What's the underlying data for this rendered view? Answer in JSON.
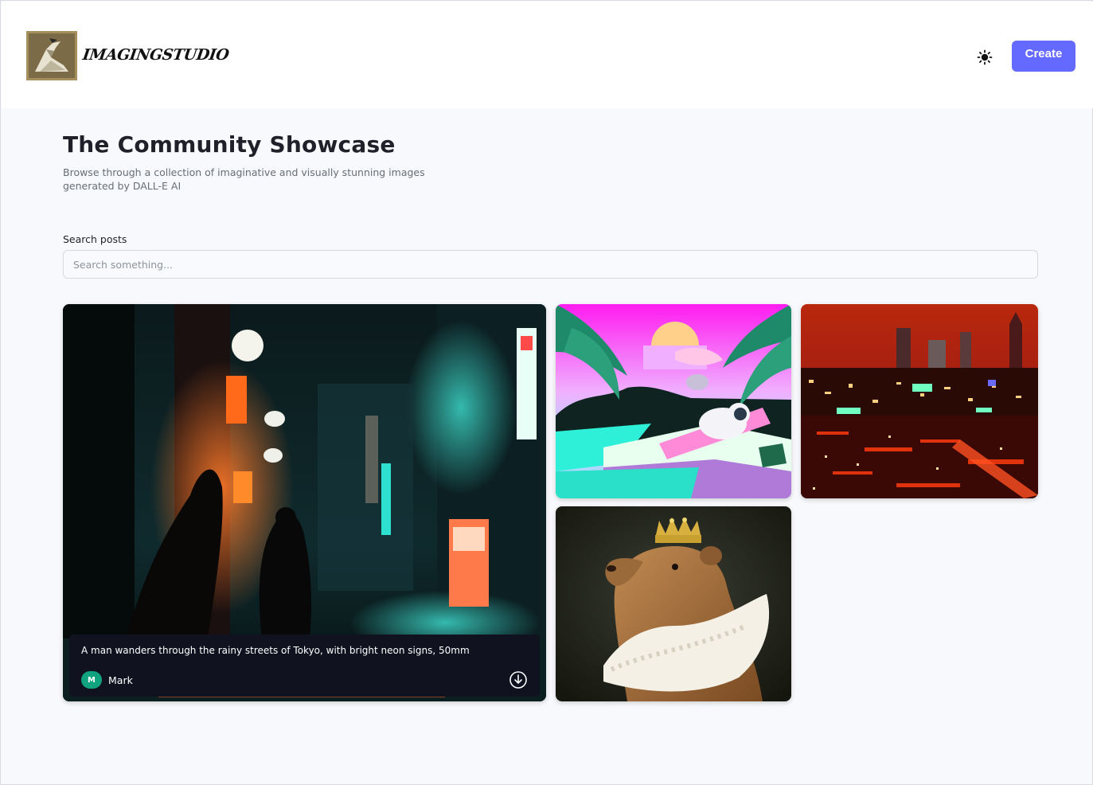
{
  "header": {
    "logo_text": "IMAGINGSTUDIO",
    "theme_icon": "sun-icon",
    "create_label": "Create",
    "accent_color": "#6469ff"
  },
  "main": {
    "title": "The Community Showcase",
    "subtitle": "Browse through a collection of imaginative and visually stunning images generated by DALL-E AI",
    "search": {
      "label": "Search posts",
      "placeholder": "Search something...",
      "value": ""
    },
    "posts": [
      {
        "prompt": "A man wanders through the rainy streets of Tokyo, with bright neon signs, 50mm",
        "author": "Mark",
        "author_initial": "M",
        "avatar_color": "#10a37f",
        "download_icon": "download-icon"
      }
    ]
  }
}
